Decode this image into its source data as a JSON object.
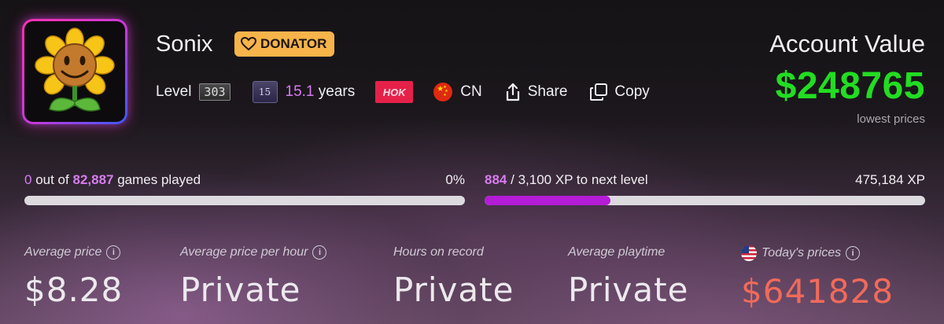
{
  "profile": {
    "username": "Sonix",
    "badge": "DONATOR",
    "level_label": "Level",
    "level": "303",
    "years_badge": "15",
    "years_num": "15.1",
    "years_unit": "years",
    "hok": "HOK",
    "country": "CN",
    "share_label": "Share",
    "copy_label": "Copy"
  },
  "account": {
    "title": "Account Value",
    "value": "$248765",
    "sub": "lowest prices"
  },
  "games": {
    "played": "0",
    "text_mid": "out of",
    "total": "82,887",
    "text_end": "games played",
    "percent": "0%",
    "progress": 0
  },
  "xp": {
    "current": "884",
    "separator": "/",
    "rest": "3,100 XP to next level",
    "total": "475,184 XP",
    "progress": 0.285
  },
  "stats": [
    {
      "label": "Average price",
      "value": "$8.28"
    },
    {
      "label": "Average price per hour",
      "value": "Private"
    },
    {
      "label": "Hours on record",
      "value": "Private"
    },
    {
      "label": "Average playtime",
      "value": "Private"
    },
    {
      "label": "Today's prices",
      "value": "$641828"
    }
  ],
  "colors": {
    "account_value": "#22dd22",
    "accent_purple": "#d77cf0",
    "xp_fill": "#b41cd6",
    "today_price": "#f06a5a",
    "badge_bg": "#f6b44a"
  },
  "icons": [
    "sunflower-avatar",
    "heart-icon",
    "share-icon",
    "copy-icon",
    "info-icon",
    "cn-flag-icon",
    "us-flag-icon"
  ]
}
